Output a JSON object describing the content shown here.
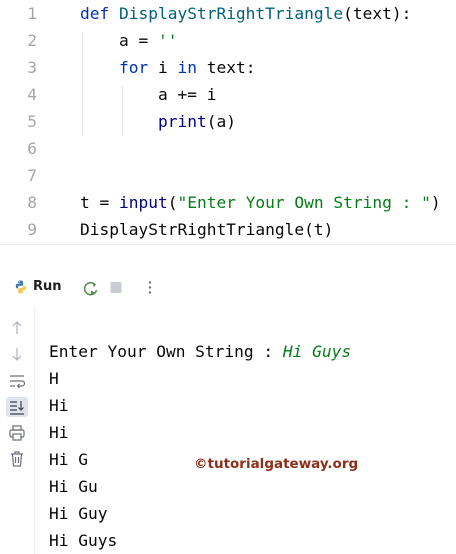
{
  "editor": {
    "lines": [
      {
        "num": "1",
        "tokens": [
          {
            "t": "def ",
            "c": "kw"
          },
          {
            "t": "DisplayStrRightTriangle",
            "c": "fn"
          },
          {
            "t": "(text):",
            "c": ""
          }
        ]
      },
      {
        "num": "2",
        "tokens": [
          {
            "t": "    a = ",
            "c": ""
          },
          {
            "t": "''",
            "c": "str"
          }
        ]
      },
      {
        "num": "3",
        "tokens": [
          {
            "t": "    ",
            "c": ""
          },
          {
            "t": "for",
            "c": "kw"
          },
          {
            "t": " i ",
            "c": ""
          },
          {
            "t": "in",
            "c": "kw"
          },
          {
            "t": " text:",
            "c": ""
          }
        ]
      },
      {
        "num": "4",
        "tokens": [
          {
            "t": "        a += i",
            "c": ""
          }
        ]
      },
      {
        "num": "5",
        "tokens": [
          {
            "t": "        ",
            "c": ""
          },
          {
            "t": "print",
            "c": "bi"
          },
          {
            "t": "(a)",
            "c": ""
          }
        ]
      },
      {
        "num": "6",
        "tokens": []
      },
      {
        "num": "7",
        "tokens": []
      },
      {
        "num": "8",
        "tokens": [
          {
            "t": "t = ",
            "c": ""
          },
          {
            "t": "input",
            "c": "bi"
          },
          {
            "t": "(",
            "c": ""
          },
          {
            "t": "\"Enter Your Own String : \"",
            "c": "str"
          },
          {
            "t": ")",
            "c": ""
          }
        ]
      },
      {
        "num": "9",
        "tokens": [
          {
            "t": "DisplayStrRightTriangle(t)",
            "c": ""
          }
        ]
      }
    ]
  },
  "run_panel": {
    "tab_label": "Run",
    "toolbar_icons": [
      "python-icon",
      "rerun-icon",
      "stop-icon",
      "more-options-icon"
    ],
    "gutter_icons": [
      "scroll-up-icon",
      "scroll-down-icon",
      "soft-wrap-icon",
      "scroll-to-end-icon",
      "print-icon",
      "trash-icon"
    ]
  },
  "console": {
    "prompt": "Enter Your Own String : ",
    "user_input": "Hi Guys",
    "output_lines": [
      "H",
      "Hi",
      "Hi",
      "Hi G",
      "Hi Gu",
      "Hi Guy",
      "Hi Guys"
    ]
  },
  "watermark": "©tutorialgateway.org",
  "colors": {
    "keyword": "#0033b3",
    "function_name": "#00627a",
    "builtin": "#000080",
    "string": "#067d17",
    "line_number": "#a6a6a6",
    "watermark": "#8c2f1b"
  }
}
